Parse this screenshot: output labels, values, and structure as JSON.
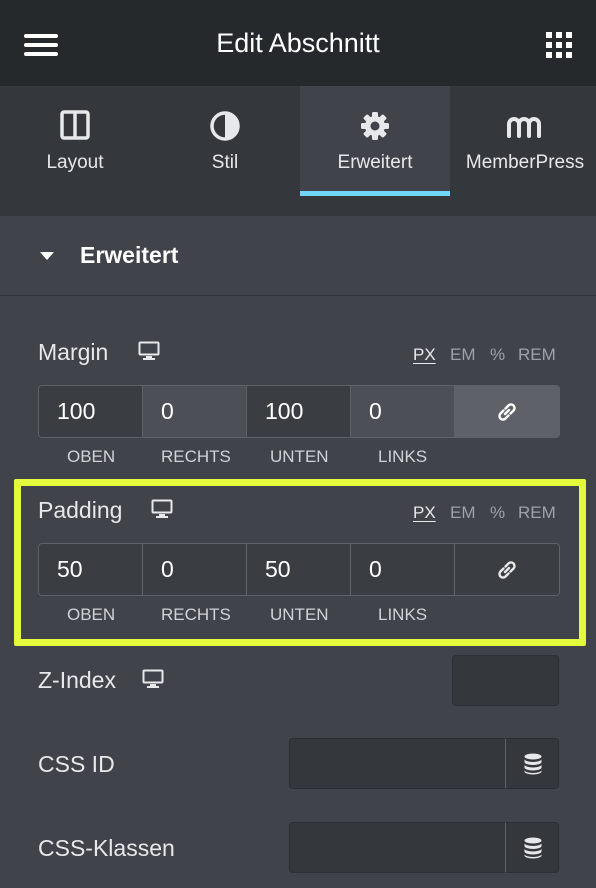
{
  "header": {
    "title": "Edit Abschnitt",
    "menu_icon": "hamburger-icon",
    "grid_icon": "apps-grid-icon"
  },
  "tabs": [
    {
      "label": "Layout",
      "icon": "layout-columns-icon"
    },
    {
      "label": "Stil",
      "icon": "contrast-icon"
    },
    {
      "label": "Erweitert",
      "icon": "gear-icon",
      "active": true
    },
    {
      "label": "MemberPress",
      "icon": "memberpress-logo-icon"
    }
  ],
  "section": {
    "title": "Erweitert"
  },
  "margin": {
    "label": "Margin",
    "units": [
      "PX",
      "EM",
      "%",
      "REM"
    ],
    "selected_unit": "PX",
    "values": [
      "100",
      "0",
      "100",
      "0"
    ],
    "sides": [
      "OBEN",
      "RECHTS",
      "UNTEN",
      "LINKS"
    ]
  },
  "padding": {
    "label": "Padding",
    "units": [
      "PX",
      "EM",
      "%",
      "REM"
    ],
    "selected_unit": "PX",
    "values": [
      "50",
      "0",
      "50",
      "0"
    ],
    "sides": [
      "OBEN",
      "RECHTS",
      "UNTEN",
      "LINKS"
    ]
  },
  "zindex": {
    "label": "Z-Index",
    "value": ""
  },
  "css_id": {
    "label": "CSS ID",
    "value": ""
  },
  "css_classes": {
    "label": "CSS-Klassen",
    "value": ""
  },
  "colors": {
    "accent": "#71d7f7",
    "highlight": "#e3fb3c",
    "panel": "#404349",
    "topbar": "#26292c"
  }
}
